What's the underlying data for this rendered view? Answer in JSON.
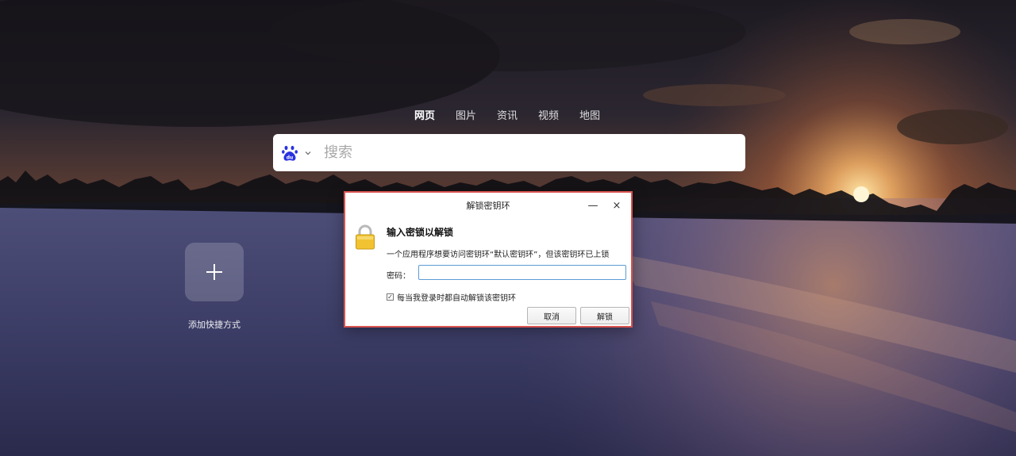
{
  "nav": {
    "tabs": [
      {
        "label": "网页",
        "active": true
      },
      {
        "label": "图片",
        "active": false
      },
      {
        "label": "资讯",
        "active": false
      },
      {
        "label": "视频",
        "active": false
      },
      {
        "label": "地图",
        "active": false
      }
    ]
  },
  "search": {
    "engine_icon": "baidu-logo-icon",
    "placeholder": "搜索",
    "value": ""
  },
  "shortcut": {
    "add_icon": "plus-icon",
    "label": "添加快捷方式"
  },
  "dialog": {
    "title": "解锁密钥环",
    "minimize_glyph": "—",
    "close_glyph": "×",
    "lock_icon": "padlock-icon",
    "heading": "输入密锁以解锁",
    "description": "一个应用程序想要访问密钥环“默认密钥环”，但该密钥环已上锁",
    "password_label": "密码：",
    "password_value": "",
    "auto_unlock_checked": true,
    "auto_unlock_label": "每当我登录时都自动解锁该密钥环",
    "cancel_label": "取消",
    "unlock_label": "解锁"
  },
  "colors": {
    "dialog_border": "#d9534f",
    "input_focus": "#5b9bd5",
    "baidu_blue": "#2932e1"
  }
}
